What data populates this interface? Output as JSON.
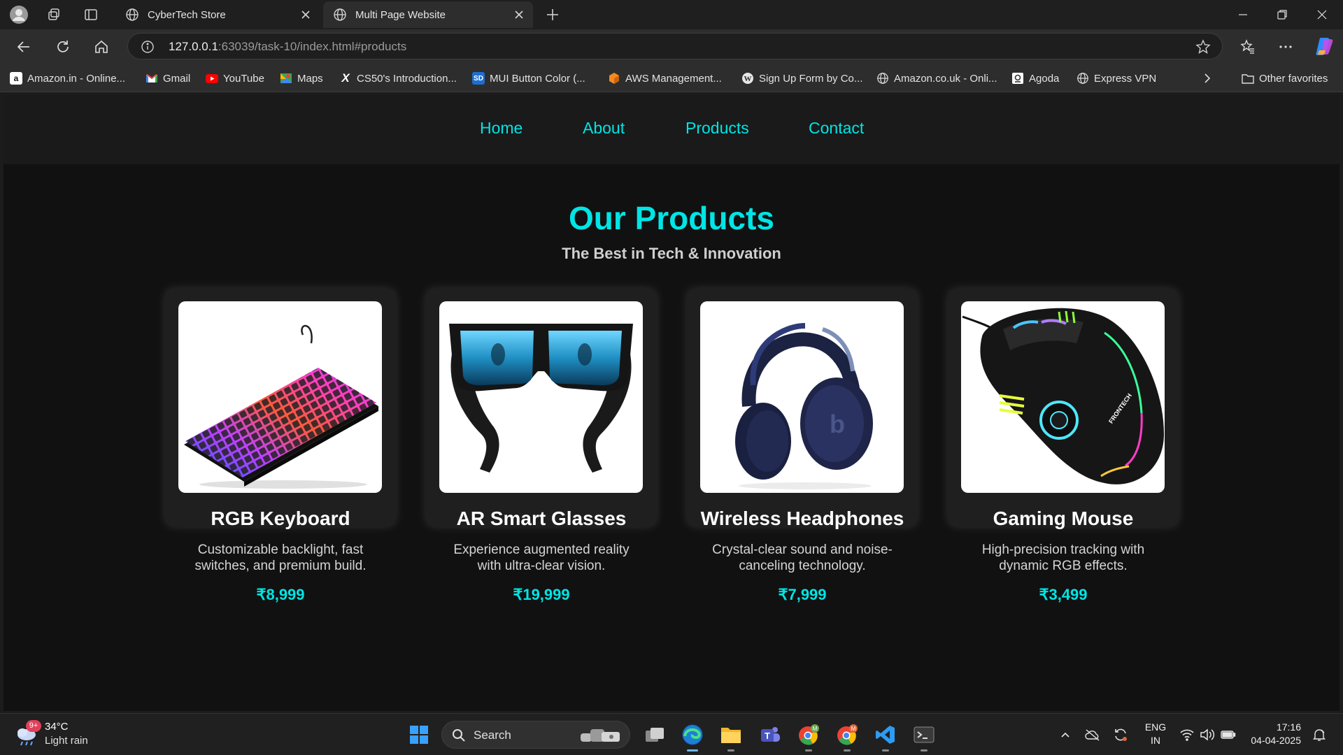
{
  "browser": {
    "tabs": [
      {
        "title": "CyberTech Store",
        "active": false
      },
      {
        "title": "Multi Page Website",
        "active": true
      }
    ],
    "url_host": "127.0.0.1",
    "url_rest": ":63039/task-10/index.html#products",
    "bookmarks": [
      {
        "label": "Amazon.in - Online...",
        "icon": "amazon-icon"
      },
      {
        "label": "Gmail",
        "icon": "gmail-icon"
      },
      {
        "label": "YouTube",
        "icon": "youtube-icon"
      },
      {
        "label": "Maps",
        "icon": "maps-icon"
      },
      {
        "label": "CS50's Introduction...",
        "icon": "x-icon"
      },
      {
        "label": "MUI Button Color (...",
        "icon": "sd-icon"
      },
      {
        "label": "AWS Management...",
        "icon": "aws-icon"
      },
      {
        "label": "Sign Up Form by Co...",
        "icon": "wordpress-icon"
      },
      {
        "label": "Amazon.co.uk - Onli...",
        "icon": "globe-icon"
      },
      {
        "label": "Agoda",
        "icon": "agoda-icon"
      },
      {
        "label": "Express VPN",
        "icon": "globe-icon"
      }
    ],
    "other_favorites": "Other favorites"
  },
  "site": {
    "nav": [
      "Home",
      "About",
      "Products",
      "Contact"
    ],
    "heading": "Our Products",
    "subheading": "The Best in Tech & Innovation",
    "accent_color": "#00e5e5",
    "products": [
      {
        "name": "RGB Keyboard",
        "description": "Customizable backlight, fast switches, and premium build.",
        "price": "₹8,999"
      },
      {
        "name": "AR Smart Glasses",
        "description": "Experience augmented reality with ultra-clear vision.",
        "price": "₹19,999"
      },
      {
        "name": "Wireless Headphones",
        "description": "Crystal-clear sound and noise-canceling technology.",
        "price": "₹7,999"
      },
      {
        "name": "Gaming Mouse",
        "description": "High-precision tracking with dynamic RGB effects.",
        "price": "₹3,499"
      }
    ]
  },
  "taskbar": {
    "weather_temp": "34°C",
    "weather_desc": "Light rain",
    "weather_badge": "9+",
    "search_label": "Search",
    "lang_line1": "ENG",
    "lang_line2": "IN",
    "time": "17:16",
    "date": "04-04-2025"
  }
}
